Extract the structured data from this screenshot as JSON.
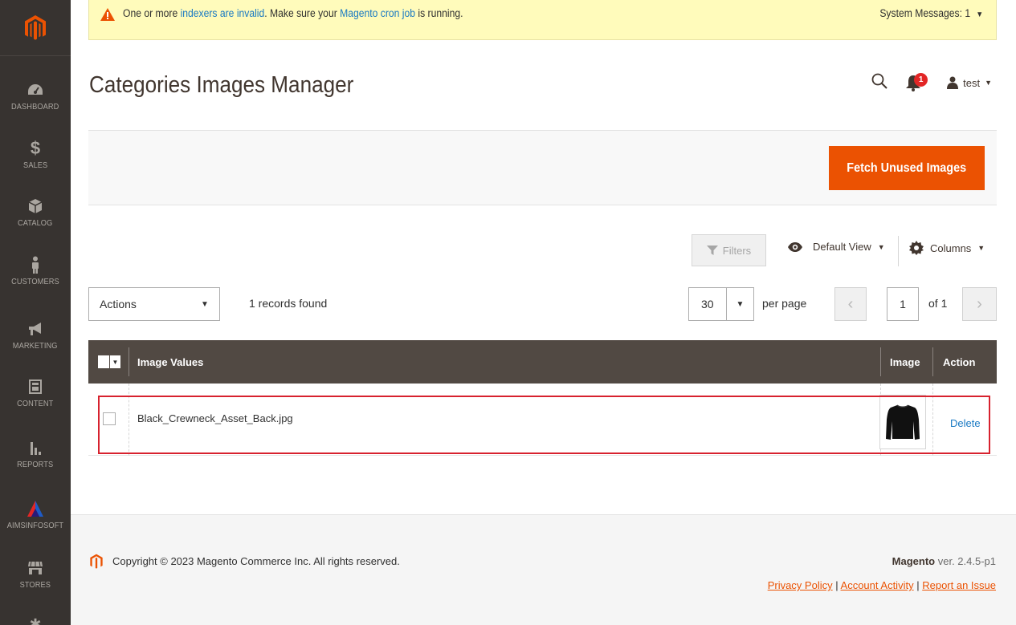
{
  "sidebar": {
    "items": [
      {
        "label": "DASHBOARD",
        "icon": "dashboard-icon"
      },
      {
        "label": "SALES",
        "icon": "dollar-icon"
      },
      {
        "label": "CATALOG",
        "icon": "box-icon"
      },
      {
        "label": "CUSTOMERS",
        "icon": "person-icon"
      },
      {
        "label": "MARKETING",
        "icon": "megaphone-icon"
      },
      {
        "label": "CONTENT",
        "icon": "layout-icon"
      },
      {
        "label": "REPORTS",
        "icon": "bar-chart-icon"
      },
      {
        "label": "AIMSINFOSOFT",
        "icon": "aims-logo-icon"
      },
      {
        "label": "STORES",
        "icon": "store-icon"
      }
    ]
  },
  "system_message": {
    "prefix": "One or more ",
    "link1": "indexers are invalid",
    "middle": ". Make sure your ",
    "link2": "Magento cron job",
    "suffix": " is running.",
    "count_label": "System Messages: 1"
  },
  "header": {
    "title": "Categories Images Manager",
    "notifications_count": "1",
    "user_name": "test"
  },
  "page_actions": {
    "fetch_label": "Fetch Unused Images"
  },
  "toolbar": {
    "filters_label": "Filters",
    "view_label": "Default View",
    "columns_label": "Columns",
    "actions_label": "Actions",
    "records_found": "1 records found",
    "per_page_value": "30",
    "per_page_label": "per page",
    "current_page": "1",
    "of_pages": "of 1"
  },
  "grid": {
    "columns": [
      "Image Values",
      "Image",
      "Action"
    ],
    "rows": [
      {
        "image_value": "Black_Crewneck_Asset_Back.jpg",
        "action": "Delete"
      }
    ]
  },
  "footer": {
    "copyright": "Copyright © 2023 Magento Commerce Inc. All rights reserved.",
    "brand": "Magento",
    "version": " ver. 2.4.5-p1",
    "privacy": "Privacy Policy",
    "activity": "Account Activity",
    "report": "Report an Issue",
    "divider": "|"
  },
  "colors": {
    "sidebar_bg": "#373330",
    "accent": "#eb5202",
    "grid_header": "#514943",
    "link": "#1979c3",
    "highlight": "#d7222e"
  }
}
